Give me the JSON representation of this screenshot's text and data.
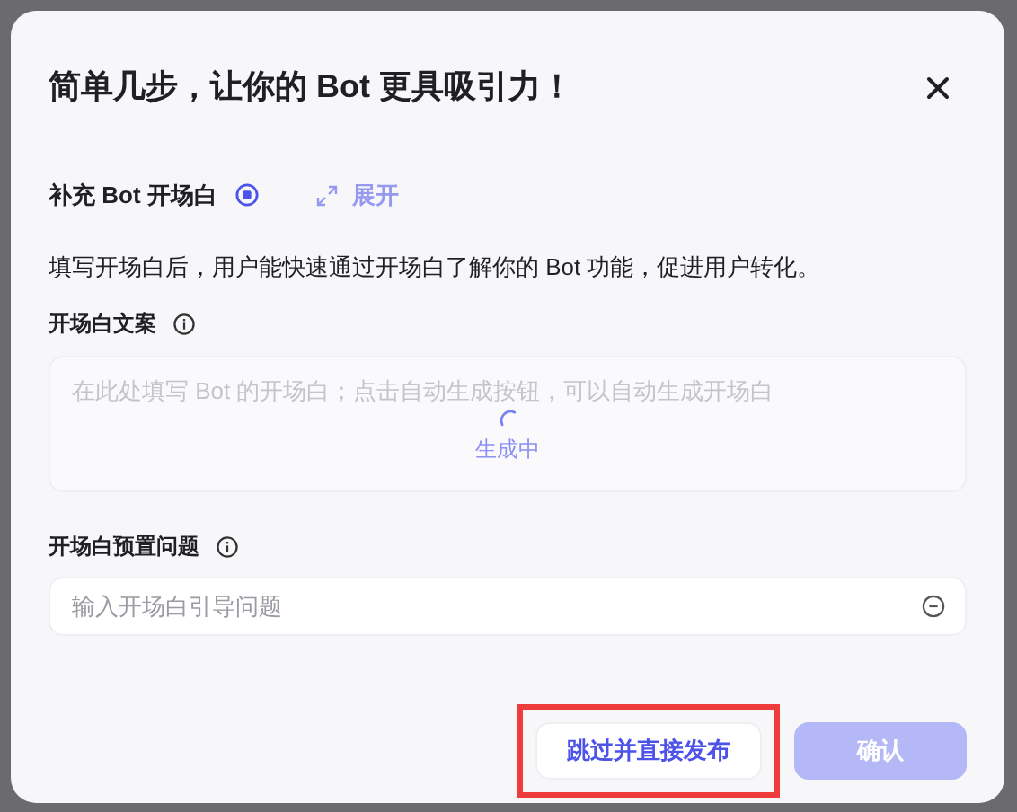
{
  "dialog": {
    "title": "简单几步，让你的 Bot 更具吸引力！",
    "section": {
      "label": "补充 Bot 开场白",
      "expand_label": "展开",
      "expand_disabled": true
    },
    "description": "填写开场白后，用户能快速通过开场白了解你的 Bot 功能，促进用户转化。",
    "opening_text": {
      "label": "开场白文案",
      "placeholder": "在此处填写 Bot 的开场白；点击自动生成按钮，可以自动生成开场白",
      "loading": true,
      "loading_label": "生成中"
    },
    "preset_question": {
      "label": "开场白预置问题",
      "placeholder": "输入开场白引导问题"
    },
    "buttons": [
      {
        "label": "跳过并直接发布",
        "kind": "secondary",
        "disabled": false,
        "highlighted": true
      },
      {
        "label": "确认",
        "kind": "primary",
        "disabled": true,
        "highlighted": false
      }
    ]
  }
}
